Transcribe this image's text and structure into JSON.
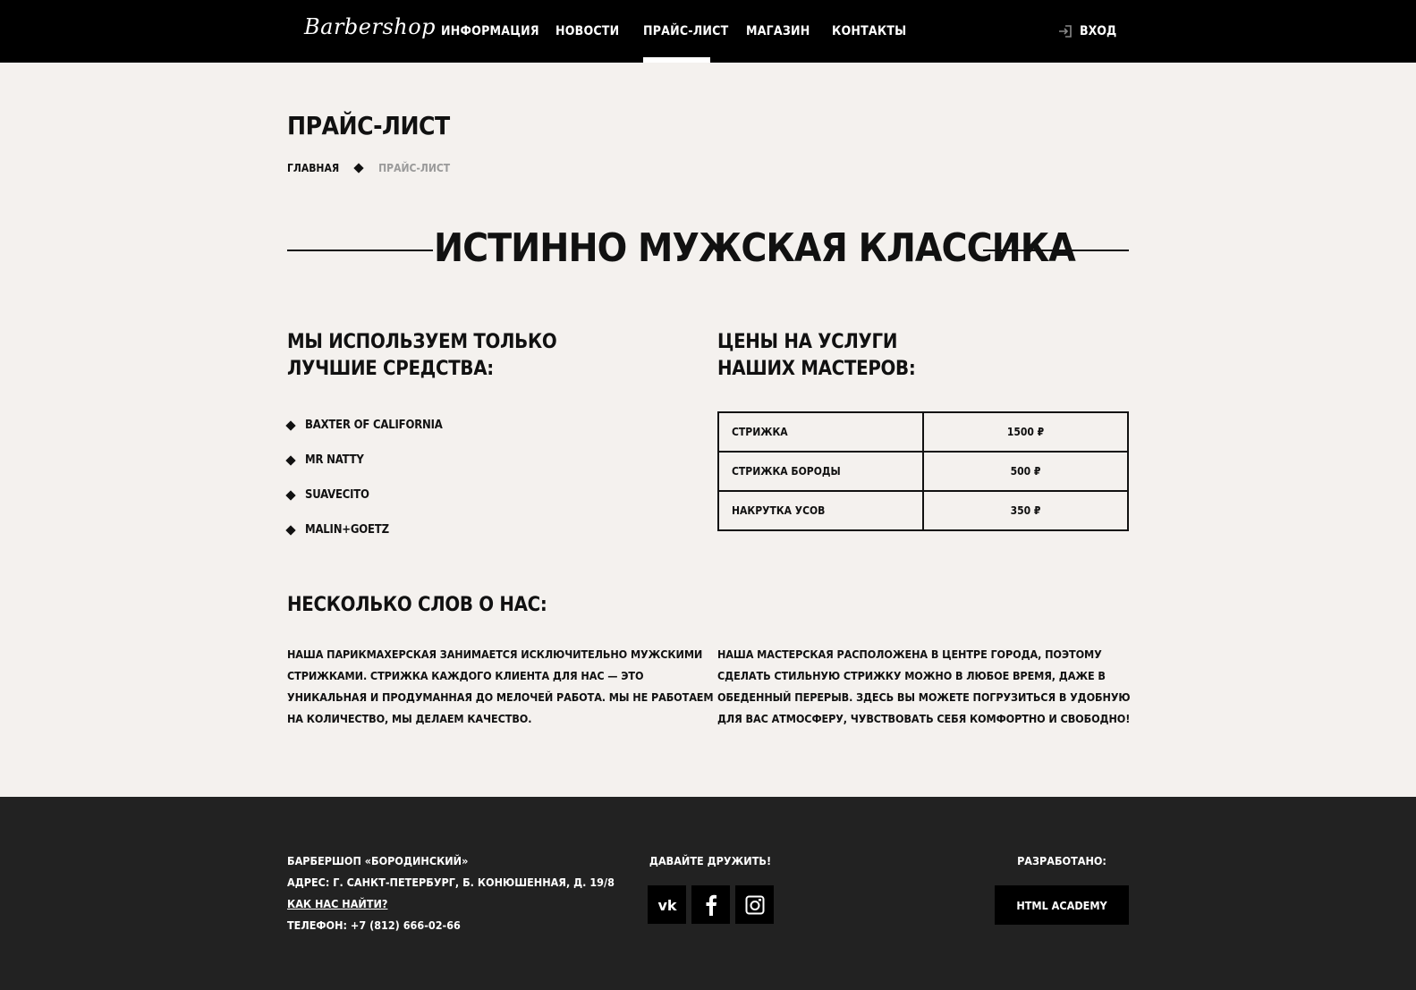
{
  "header": {
    "logo": "Barbershop",
    "nav": [
      {
        "label": "ИНФОРМАЦИЯ"
      },
      {
        "label": "НОВОСТИ"
      },
      {
        "label": "ПРАЙС-ЛИСТ"
      },
      {
        "label": "МАГАЗИН"
      },
      {
        "label": "КОНТАКТЫ"
      }
    ],
    "login_label": "ВХОД"
  },
  "page": {
    "title": "ПРАЙС-ЛИСТ",
    "breadcrumb": {
      "home": "ГЛАВНАЯ",
      "current": "ПРАЙС-ЛИСТ"
    },
    "hero_heading": "ИСТИННО МУЖСКАЯ КЛАССИКА"
  },
  "products": {
    "heading_line1": "МЫ ИСПОЛЬЗУЕМ ТОЛЬКО",
    "heading_line2": "ЛУЧШИЕ СРЕДСТВА:",
    "items": [
      "BAXTER OF CALIFORNIA",
      "MR NATTY",
      "SUAVECITO",
      "MALIN+GOETZ"
    ]
  },
  "prices": {
    "heading_line1": "ЦЕНЫ НА УСЛУГИ",
    "heading_line2": "НАШИХ МАСТЕРОВ:",
    "rows": [
      {
        "service": "СТРИЖКА",
        "price": "1500 ₽"
      },
      {
        "service": "СТРИЖКА БОРОДЫ",
        "price": "500 ₽"
      },
      {
        "service": "НАКРУТКА УСОВ",
        "price": "350 ₽"
      }
    ]
  },
  "about": {
    "heading": "НЕСКОЛЬКО СЛОВ О НАС:",
    "left_lines": [
      "НАША ПАРИКМАХЕРСКАЯ ЗАНИМАЕТСЯ ИСКЛЮЧИТЕЛЬНО МУЖСКИМИ",
      "СТРИЖКАМИ. СТРИЖКА КАЖДОГО КЛИЕНТА ДЛЯ НАС — ЭТО",
      "УНИКАЛЬНАЯ И ПРОДУМАННАЯ ДО МЕЛОЧЕЙ РАБОТА. МЫ НЕ РАБОТАЕМ",
      "НА КОЛИЧЕСТВО, МЫ ДЕЛАЕМ КАЧЕСТВО."
    ],
    "right_lines": [
      "НАША МАСТЕРСКАЯ РАСПОЛОЖЕНА В ЦЕНТРЕ ГОРОДА, ПОЭТОМУ",
      "СДЕЛАТЬ СТИЛЬНУЮ СТРИЖКУ МОЖНО В ЛЮБОЕ ВРЕМЯ, ДАЖЕ В",
      "ОБЕДЕННЫЙ ПЕРЕРЫВ. ЗДЕСЬ ВЫ МОЖЕТЕ ПОГРУЗИТЬСЯ В УДОБНУЮ",
      "ДЛЯ ВАС АТМОСФЕРУ, ЧУВСТВОВАТЬ СЕБЯ КОМФОРТНО И СВОБОДНО!"
    ]
  },
  "footer": {
    "name": "БАРБЕРШОП «БОРОДИНСКИЙ»",
    "address": "АДРЕС: Г. САНКТ-ПЕТЕРБУРГ, Б. КОНЮШЕННАЯ, Д. 19/8",
    "directions_link": "КАК НАС НАЙТИ?",
    "phone": "ТЕЛЕФОН: +7 (812) 666-02-66",
    "social_title": "ДАВАЙТЕ ДРУЖИТЬ!",
    "social_icons": [
      "vk-icon",
      "facebook-icon",
      "instagram-icon"
    ],
    "dev_title": "РАЗРАБОТАНО:",
    "dev_button": "HTML ACADEMY"
  }
}
